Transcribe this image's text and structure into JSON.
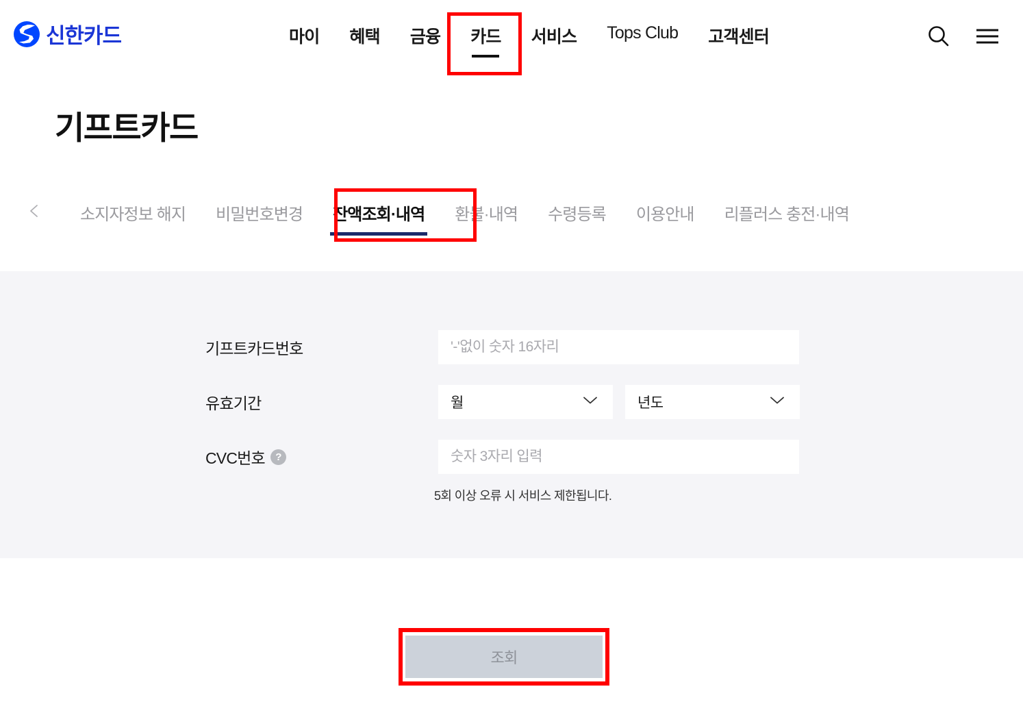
{
  "header": {
    "logo_text": "신한카드",
    "logo_icon": "shinhan-swirl-icon",
    "nav_items": [
      {
        "label": "마이",
        "active": false
      },
      {
        "label": "혜택",
        "active": false
      },
      {
        "label": "금융",
        "active": false
      },
      {
        "label": "카드",
        "active": true
      },
      {
        "label": "서비스",
        "active": false
      },
      {
        "label": "Tops Club",
        "active": false
      },
      {
        "label": "고객센터",
        "active": false
      }
    ],
    "search_icon": "search-icon",
    "menu_icon": "hamburger-menu-icon",
    "highlight_color": "#ff0000"
  },
  "page_title": "기프트카드",
  "tabs": {
    "prev_icon": "chevron-left-icon",
    "items": [
      {
        "label": "소지자정보 해지",
        "active": false
      },
      {
        "label": "비밀번호변경",
        "active": false
      },
      {
        "label": "잔액조회·내역",
        "active": true
      },
      {
        "label": "환불·내역",
        "active": false
      },
      {
        "label": "수령등록",
        "active": false
      },
      {
        "label": "이용안내",
        "active": false
      },
      {
        "label": "리플러스 충전·내역",
        "active": false
      }
    ],
    "active_underline_color": "#1b2a6b"
  },
  "form": {
    "card_number": {
      "label": "기프트카드번호",
      "placeholder": "'-'없이 숫자 16자리",
      "value": ""
    },
    "expiry": {
      "label": "유효기간",
      "month_selected": "월",
      "year_selected": "년도",
      "dropdown_icon": "chevron-down-icon"
    },
    "cvc": {
      "label": "CVC번호",
      "help_icon": "question-mark-icon",
      "help_glyph": "?",
      "placeholder": "숫자 3자리 입력",
      "value": ""
    },
    "hint": "5회 이상 오류 시 서비스 제한됩니다."
  },
  "submit": {
    "label": "조회",
    "disabled": true,
    "background": "#ccd2da",
    "text_color": "#8e9299"
  }
}
